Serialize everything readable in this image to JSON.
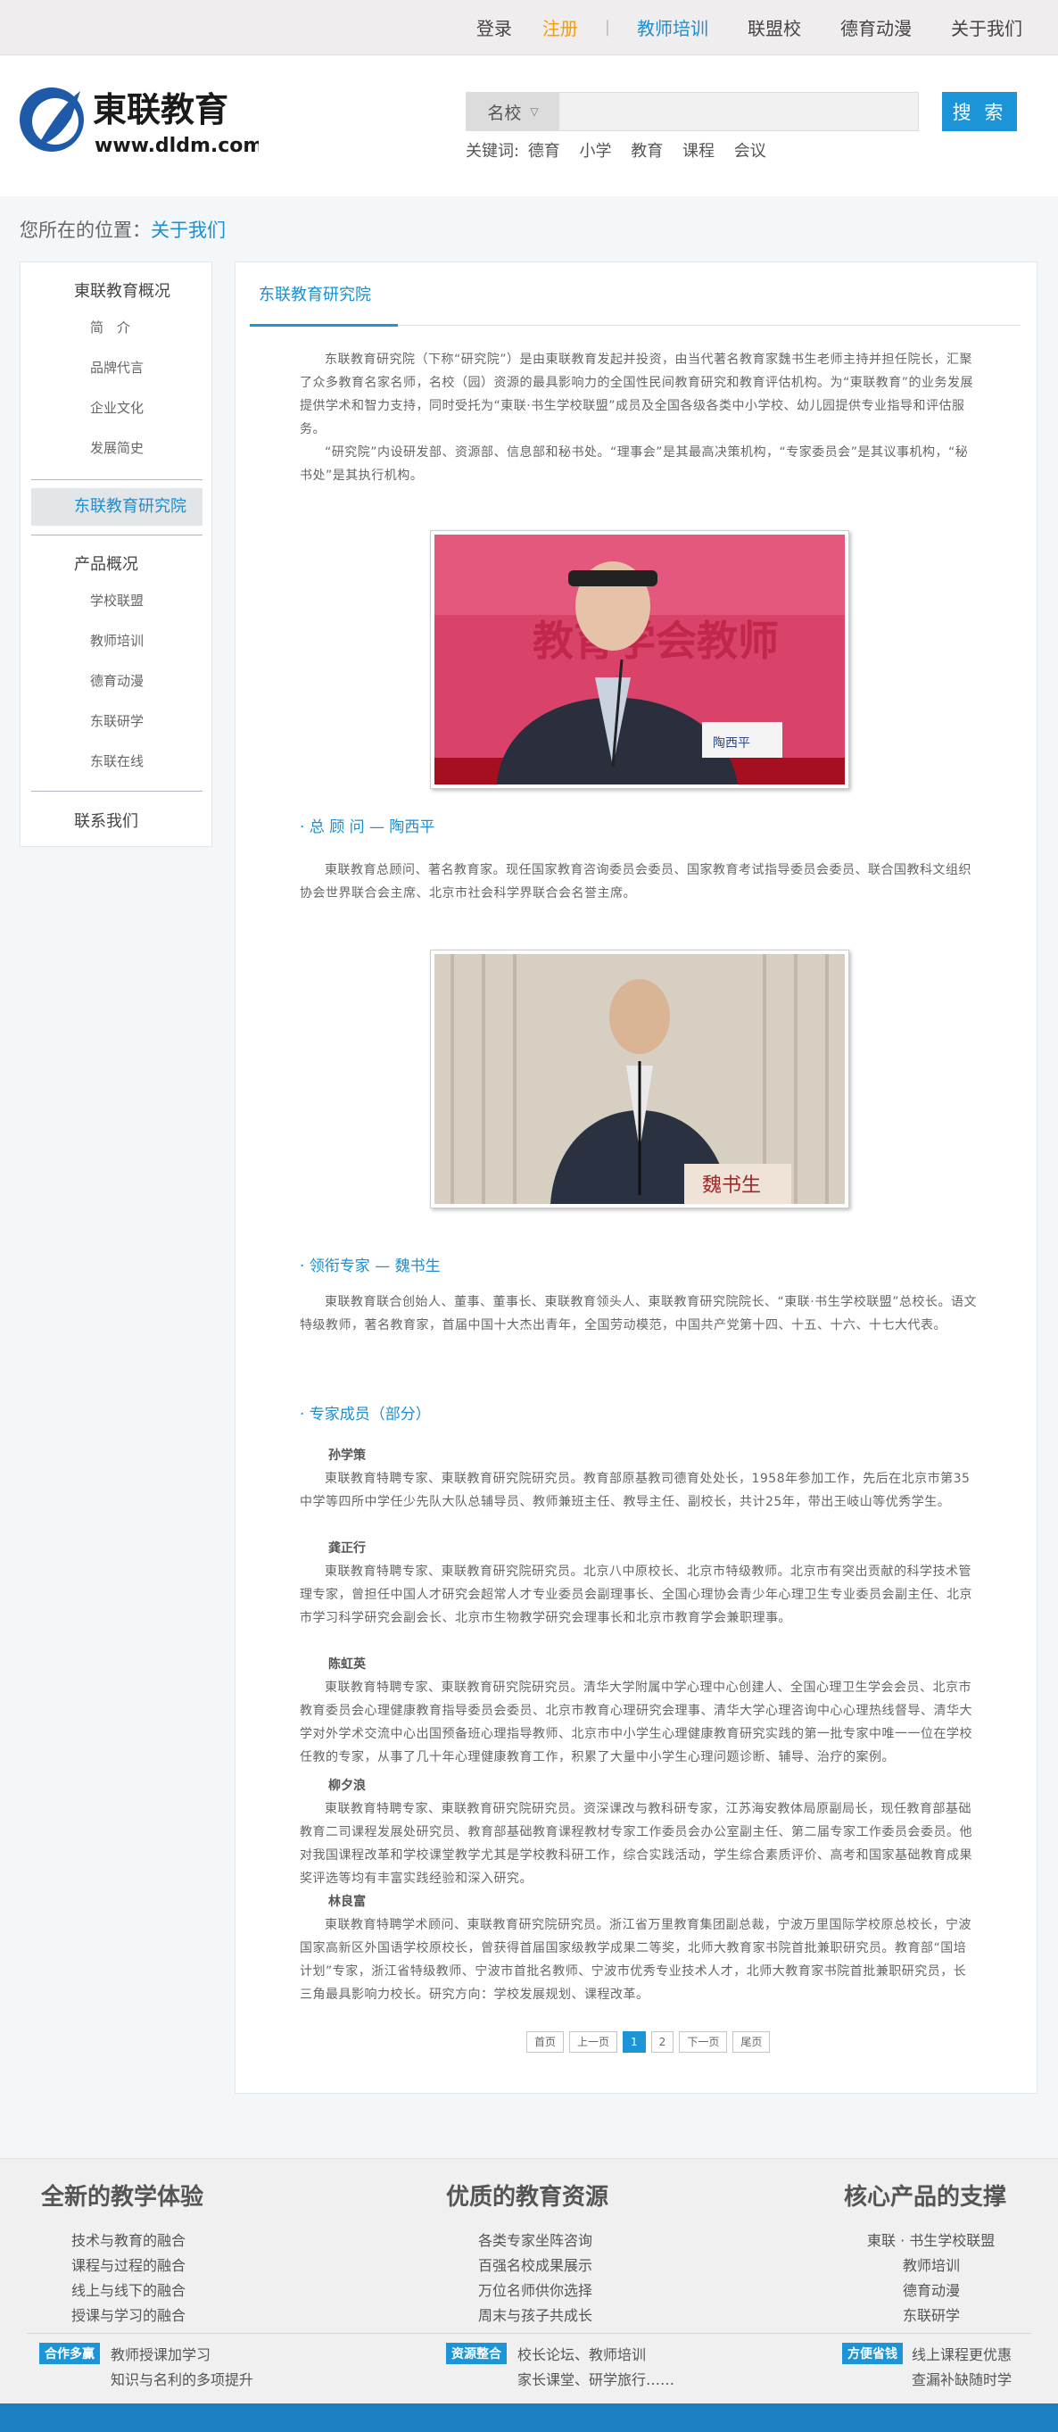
{
  "topnav": {
    "login": "登录",
    "register": "注册",
    "sep": "|",
    "items": [
      "教师培训",
      "联盟校",
      "德育动漫",
      "关于我们"
    ]
  },
  "brand": {
    "name": "東联教育",
    "url": "www.dldm.com",
    "colors": {
      "logo": "#1e5aa8",
      "accent": "#1b94d8"
    }
  },
  "search": {
    "category": "名校",
    "placeholder": "",
    "button": "搜 索"
  },
  "keywords": {
    "label": "关键词:",
    "items": [
      "德育",
      "小学",
      "教育",
      "课程",
      "会议"
    ]
  },
  "breadcrumb": {
    "prefix": "您所在的位置：",
    "current": "关于我们"
  },
  "sidebar": {
    "group1": "東联教育概况",
    "group1_items": [
      "简　介",
      "品牌代言",
      "企业文化",
      "发展简史"
    ],
    "active": "东联教育研究院",
    "group2": "产品概况",
    "group2_items": [
      "学校联盟",
      "教师培训",
      "德育动漫",
      "东联研学",
      "东联在线"
    ],
    "group3": "联系我们"
  },
  "content": {
    "tab": "东联教育研究院",
    "intro_p1": "东联教育研究院（下称“研究院”）是由東联教育发起并投资，由当代著名教育家魏书生老师主持并担任院长，汇聚了众多教育名家名师，名校（园）资源的最具影响力的全国性民间教育研究和教育评估机构。为“東联教育”的业务发展提供学术和智力支持，同时受托为“東联·书生学校联盟”成员及全国各级各类中小学校、幼儿园提供专业指导和评估服务。",
    "intro_p2": "“研究院”内设研发部、资源部、信息部和秘书处。“理事会”是其最高决策机构，“专家委员会”是其议事机构，“秘书处”是其执行机构。",
    "advisor_title": "· 总 顾 问 — 陶西平",
    "advisor_text": "東联教育总顾问、著名教育家。现任国家教育咨询委员会委员、国家教育考试指导委员会委员、联合国教科文组织协会世界联合会主席、北京市社会科学界联合会名誉主席。",
    "photo1_caption": "陶西平",
    "photo1_banner": "教育学会教师",
    "photo2_caption": "魏书生",
    "lead_title": "· 领衔专家 — 魏书生",
    "lead_text": "東联教育联合创始人、董事、董事长、東联教育领头人、東联教育研究院院长、“東联·书生学校联盟”总校长。语文特级教师，著名教育家，首届中国十大杰出青年，全国劳动模范，中国共产党第十四、十五、十六、十七大代表。",
    "members_title": "· 专家成员（部分）",
    "members": [
      {
        "name": "孙学策",
        "text": "東联教育特聘专家、東联教育研究院研究员。教育部原基教司德育处处长，1958年参加工作，先后在北京市第35中学等四所中学任少先队大队总辅导员、教师兼班主任、教导主任、副校长，共计25年，带出王岐山等优秀学生。"
      },
      {
        "name": "龚正行",
        "text": "東联教育特聘专家、東联教育研究院研究员。北京八中原校长、北京市特级教师。北京市有突出贡献的科学技术管理专家，曾担任中国人才研究会超常人才专业委员会副理事长、全国心理协会青少年心理卫生专业委员会副主任、北京市学习科学研究会副会长、北京市生物教学研究会理事长和北京市教育学会兼职理事。"
      },
      {
        "name": "陈虹英",
        "text": "東联教育特聘专家、東联教育研究院研究员。清华大学附属中学心理中心创建人、全国心理卫生学会会员、北京市教育委员会心理健康教育指导委员会委员、北京市教育心理研究会理事、清华大学心理咨询中心心理热线督导、清华大学对外学术交流中心出国预备班心理指导教师、北京市中小学生心理健康教育研究实践的第一批专家中唯一一位在学校任教的专家，从事了几十年心理健康教育工作，积累了大量中小学生心理问题诊断、辅导、治疗的案例。"
      },
      {
        "name": "柳夕浪",
        "text": "東联教育特聘专家、東联教育研究院研究员。资深课改与教科研专家，江苏海安教体局原副局长，现任教育部基础教育二司课程发展处研究员、教育部基础教育课程教材专家工作委员会办公室副主任、第二届专家工作委员会委员。他对我国课程改革和学校课堂教学尤其是学校教科研工作，综合实践活动，学生综合素质评价、高考和国家基础教育成果奖评选等均有丰富实践经验和深入研究。"
      },
      {
        "name": "林良富",
        "text": "東联教育特聘学术顾问、東联教育研究院研究员。浙江省万里教育集团副总裁，宁波万里国际学校原总校长，宁波国家高新区外国语学校原校长，曾获得首届国家级教学成果二等奖，北师大教育家书院首批兼职研究员。教育部“国培计划”专家，浙江省特级教师、宁波市首批名教师、宁波市优秀专业技术人才，北师大教育家书院首批兼职研究员，长三角最具影响力校长。研究方向：学校发展规划、课程改革。"
      }
    ]
  },
  "pager": {
    "items": [
      "首页",
      "上一页",
      "1",
      "2",
      "下一页",
      "尾页"
    ],
    "current": "1"
  },
  "footer": {
    "col1": {
      "title": "全新的教学体验",
      "items": [
        "技术与教育的融合",
        "课程与过程的融合",
        "线上与线下的融合",
        "授课与学习的融合"
      ]
    },
    "col2": {
      "title": "优质的教育资源",
      "items": [
        "各类专家坐阵咨询",
        "百强名校成果展示",
        "万位名师供你选择",
        "周末与孩子共成长"
      ]
    },
    "col3": {
      "title": "核心产品的支撑",
      "items": [
        "東联 · 书生学校联盟",
        "教师培训",
        "德育动漫",
        "东联研学"
      ]
    },
    "badges": [
      {
        "label": "合作多赢",
        "line1": "教师授课加学习",
        "line2": "知识与名利的多项提升"
      },
      {
        "label": "资源整合",
        "line1": "校长论坛、教师培训",
        "line2": "家长课堂、研学旅行……"
      },
      {
        "label": "方便省钱",
        "line1": "线上课程更优惠",
        "line2": "查漏补缺随时学"
      }
    ]
  }
}
